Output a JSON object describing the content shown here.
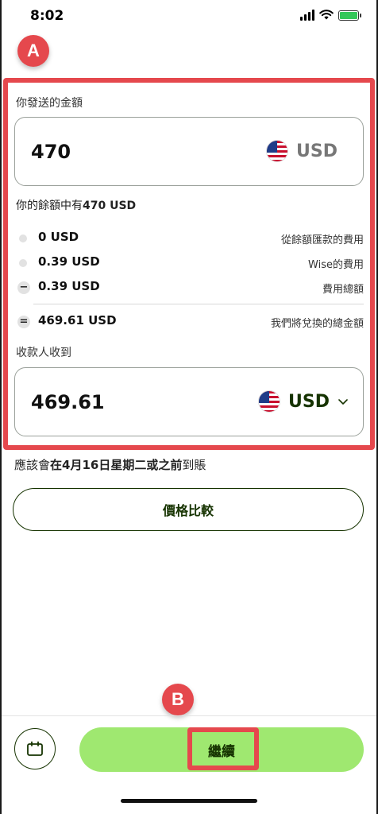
{
  "status": {
    "time": "8:02"
  },
  "markers": {
    "a": "A",
    "b": "B"
  },
  "send": {
    "label": "你發送的金額",
    "amount": "470",
    "currency": "USD"
  },
  "balance_note": {
    "prefix": "你的餘額中有",
    "amount": "470 USD"
  },
  "fees": [
    {
      "icon": "dot",
      "value": "0 USD",
      "desc": "從餘額匯款的費用"
    },
    {
      "icon": "dot",
      "value": "0.39 USD",
      "desc": "Wise的費用"
    },
    {
      "icon": "minus",
      "value": "0.39 USD",
      "desc": "費用總額"
    }
  ],
  "convert": {
    "icon": "equals",
    "value": "469.61 USD",
    "desc": "我們將兌換的總金額"
  },
  "receive": {
    "label": "收款人收到",
    "amount": "469.61",
    "currency": "USD"
  },
  "arrival": {
    "pre": "應該會",
    "bold": "在4月16日星期二或之前",
    "post": "到賬"
  },
  "buttons": {
    "compare": "價格比較",
    "continue": "繼續"
  },
  "colors": {
    "accent": "#9fe870",
    "forest": "#163300",
    "annotation": "#e5484d"
  },
  "icons": {
    "calendar": "calendar-icon",
    "chevron": "chevron-down-icon",
    "flag": "us-flag-icon"
  }
}
